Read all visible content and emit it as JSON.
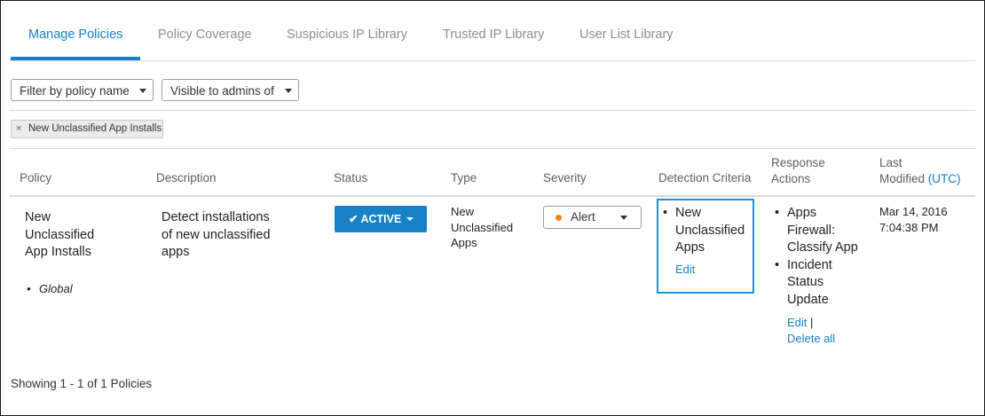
{
  "tabs": {
    "manage_policies": "Manage Policies",
    "policy_coverage": "Policy Coverage",
    "suspicious_ip": "Suspicious IP Library",
    "trusted_ip": "Trusted IP Library",
    "user_list": "User List Library"
  },
  "filters": {
    "policy_name": "Filter by policy name",
    "visible_admins": "Visible to admins of"
  },
  "chip": {
    "label": "New Unclassified App Installs",
    "remove_icon": "×"
  },
  "columns": {
    "policy": "Policy",
    "description": "Description",
    "status": "Status",
    "type": "Type",
    "severity": "Severity",
    "detection": "Detection Criteria",
    "response_line1": "Response",
    "response_line2": "Actions",
    "modified_line1": "Last",
    "modified_line2": "Modified",
    "modified_tz": "(UTC)"
  },
  "row": {
    "policy_name_lines": [
      "New",
      "Unclassified",
      "App Installs"
    ],
    "scope": "Global",
    "description_lines": [
      "Detect installations",
      "of new unclassified",
      "apps"
    ],
    "status_check": "✔",
    "status_label": "ACTIVE",
    "type_lines": [
      "New",
      "Unclassified",
      "Apps"
    ],
    "severity": "Alert",
    "detection_item_lines": [
      "New",
      "Unclassified",
      "Apps"
    ],
    "detection_edit": "Edit",
    "response_item1_lines": [
      "Apps",
      "Firewall:",
      "Classify App"
    ],
    "response_item2_lines": [
      "Incident",
      "Status",
      "Update"
    ],
    "response_edit": "Edit",
    "response_sep": "|",
    "response_delete": "Delete all",
    "modified_date": "Mar 14, 2016",
    "modified_time": "7:04:38 PM"
  },
  "colors": {
    "accent": "#1681c4",
    "severity_alert": "#f0861e"
  },
  "footer": "Showing 1 - 1 of 1 Policies"
}
